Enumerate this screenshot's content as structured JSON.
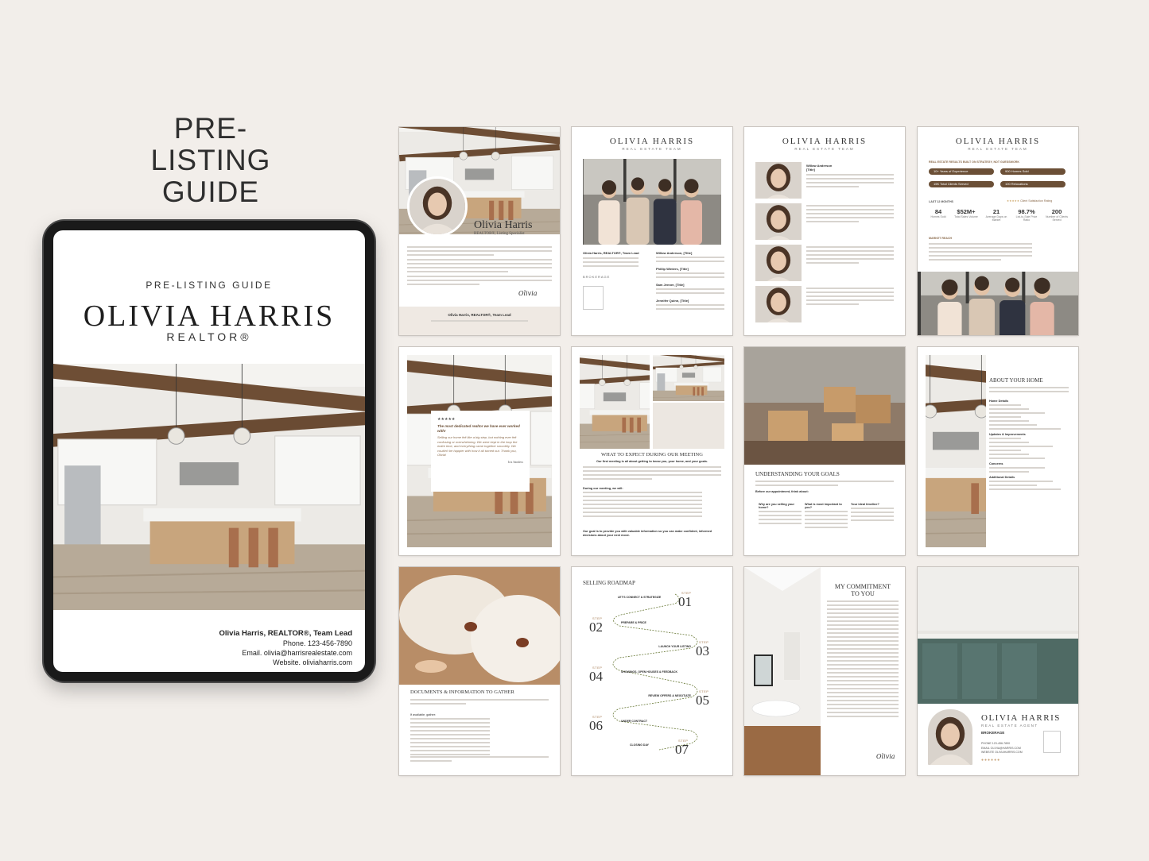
{
  "hero": {
    "title_line1": "PRE-LISTING",
    "title_line2": "GUIDE"
  },
  "tablet": {
    "kicker": "PRE-LISTING GUIDE",
    "name": "OLIVIA HARRIS",
    "role": "REALTOR®",
    "contact": {
      "line1": "Olivia Harris, REALTOR®, Team Lead",
      "line2": "Phone. 123-456-7890",
      "line3": "Email. olivia@harrisrealestate.com",
      "line4": "Website. oliviaharris.com"
    }
  },
  "pages": {
    "cover": {
      "name": "Olivia Harris",
      "subtitle": "REALTOR®, Listing Specialist",
      "footer": "Olivia Harris, REALTOR®, Team Lead",
      "signature": "Olivia"
    },
    "team": {
      "brand": "OLIVIA HARRIS",
      "brand_sub": "REAL ESTATE TEAM",
      "lead": "Olivia Harris, REALTOR®, Team Lead",
      "brokerage": "BROKERAGE",
      "m1": "Willow Anderson, [Title]",
      "m2": "Phillip Winters, [Title]",
      "m3": "Sam Jenner, [Title]",
      "m4": "Jennifer Quinn, [Title]"
    },
    "members": {
      "brand": "OLIVIA HARRIS",
      "brand_sub": "REAL ESTATE TEAM",
      "name": "Willow Anderson",
      "title": "[Title]"
    },
    "results": {
      "brand": "OLIVIA HARRIS",
      "brand_sub": "REAL ESTATE TEAM",
      "heading": "REAL ESTATE RESULTS BUILT ON STRATEGY, NOT GUESSWORK",
      "pill1": "10+ Years of Experience",
      "pill2": "900 Homes Sold",
      "pill3": "15K Total Clients Served",
      "pill4": "100 Relocations",
      "last12": "LAST 12 MONTHS",
      "rating": "Client Satisfaction Rating",
      "s1v": "84",
      "s1l": "Homes Sold",
      "s2v": "$52M+",
      "s2l": "Total Sales Volume",
      "s3v": "21",
      "s3l": "Average Days on Market",
      "s4v": "98.7%",
      "s4l": "List-to-Sale Price Ratio",
      "s5v": "200",
      "s5l": "Number of Clients Served",
      "reach": "MARKET REACH"
    },
    "testimonial": {
      "stars": "★★★★★",
      "quote_head": "The most dedicated realtor we have ever worked with!",
      "quote": "Selling our home felt like a big step, but nothing ever felt confusing or overwhelming. We were kept in the loop the entire time, and everything came together smoothly. We couldn't be happier with how it all turned out. Thank you, Olivia!",
      "author": "Iris Sanders"
    },
    "expect": {
      "heading": "WHAT TO EXPECT DURING OUR MEETING",
      "lead": "Our first meeting is all about getting to know you, your home, and your goals.",
      "during": "During our meeting, we will:",
      "goal": "Our goal is to provide you with valuable information so you can make confident, informed decisions about your next move."
    },
    "goals": {
      "heading": "UNDERSTANDING YOUR GOALS",
      "before": "Before our appointment, think about:",
      "q1": "Why are you selling your home?",
      "q2": "What is most important to you?",
      "q3": "Your ideal timeline?"
    },
    "about": {
      "heading": "ABOUT YOUR HOME",
      "details": "Home Details",
      "updates": "Updates & Improvements",
      "concerns": "Concerns",
      "additional": "Additional Details"
    },
    "documents": {
      "heading": "DOCUMENTS & INFORMATION TO GATHER",
      "ifavail": "If available, gather:"
    },
    "roadmap": {
      "heading": "SELLING ROADMAP",
      "step": "STEP",
      "n1": "01",
      "n2": "02",
      "n3": "03",
      "n4": "04",
      "n5": "05",
      "n6": "06",
      "n7": "07",
      "l1": "LET'S CONNECT & STRATEGIZE",
      "l2": "PREPARE & PRICE",
      "l3": "LAUNCH YOUR LISTING",
      "l4": "SHOWINGS, OPEN HOUSES & FEEDBACK",
      "l5": "REVIEW OFFERS & NEGOTIATE",
      "l6": "UNDER CONTRACT",
      "l7": "CLOSING DAY"
    },
    "commitment": {
      "heading1": "MY COMMITMENT",
      "heading2": "TO YOU",
      "signature": "Olivia"
    },
    "back": {
      "brand": "OLIVIA HARRIS",
      "brand_sub": "REAL ESTATE AGENT",
      "brokerage": "BROKERAGE",
      "phone": "PHONE 123-456-7890",
      "email": "EMAIL OLIVIA@HARRIS.COM",
      "website": "WEBSITE OLIVIAHARRIS.COM"
    }
  }
}
